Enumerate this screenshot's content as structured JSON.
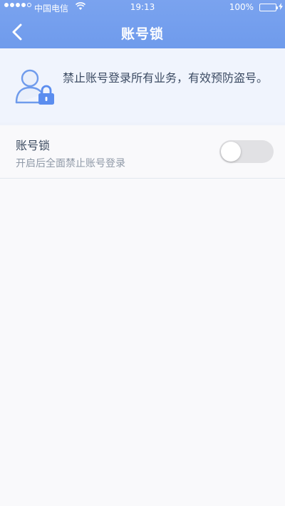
{
  "status_bar": {
    "carrier": "中国电信",
    "time": "19:13",
    "battery_percent": "100%",
    "signal_bars_filled": 4,
    "signal_bars_total": 5,
    "battery_level": 1.0,
    "icons": [
      "signal-icon",
      "wifi-icon",
      "battery-icon",
      "charging-icon"
    ]
  },
  "nav": {
    "title": "账号锁",
    "back_icon": "chevron-left-icon"
  },
  "info_banner": {
    "icon": "user-lock-icon",
    "text": "禁止账号登录所有业务，有效预防盗号。"
  },
  "setting": {
    "title": "账号锁",
    "description": "开启后全面禁止账号登录",
    "enabled": false
  },
  "colors": {
    "header": "#729eed",
    "accent": "#5b8def",
    "banner": "#f0f4fd",
    "page": "#f9f9fb",
    "toggle_off": "#e1e1e4",
    "battery": "#4cd964"
  }
}
